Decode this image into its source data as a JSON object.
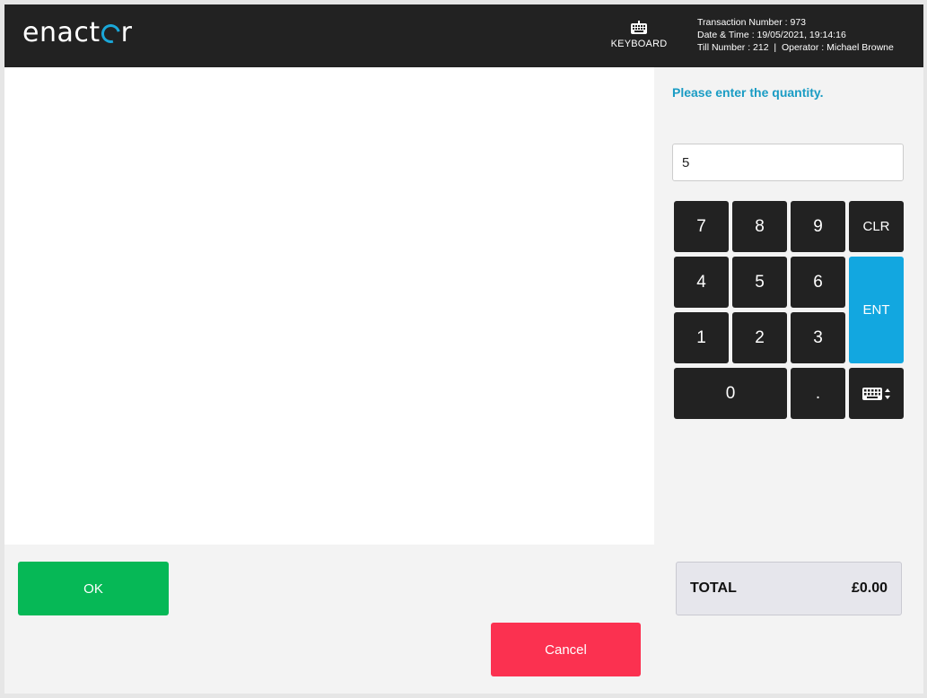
{
  "header": {
    "logo_text": "enactor",
    "keyboard_label": "KEYBOARD",
    "transaction_line": "Transaction Number : 973",
    "datetime_line": "Date & Time : 19/05/2021, 19:14:16",
    "till_operator_line": "Till Number : 212  |  Operator : Michael Browne"
  },
  "prompt": {
    "message": "Please enter the quantity.",
    "quantity_value": "5"
  },
  "keypad": {
    "k7": "7",
    "k8": "8",
    "k9": "9",
    "clr": "CLR",
    "k4": "4",
    "k5": "5",
    "k6": "6",
    "ent": "ENT",
    "k1": "1",
    "k2": "2",
    "k3": "3",
    "k0": "0",
    "dot": ".",
    "keyboard_toggle_icon": "keyboard-toggle-icon"
  },
  "actions": {
    "ok_label": "OK",
    "cancel_label": "Cancel"
  },
  "total": {
    "label": "TOTAL",
    "amount": "£0.00"
  },
  "colors": {
    "header_bg": "#222222",
    "accent_blue": "#1a9cc4",
    "ent_blue": "#12a7e0",
    "ok_green": "#06b856",
    "cancel_red": "#fb3150"
  }
}
